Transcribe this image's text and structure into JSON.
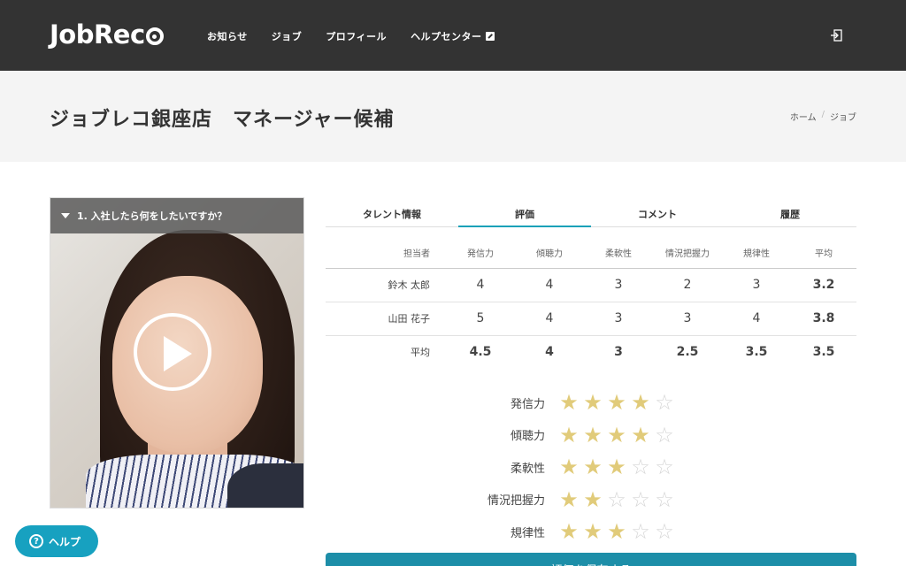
{
  "header": {
    "logo": "JobRec",
    "nav": [
      {
        "label": "お知らせ"
      },
      {
        "label": "ジョブ"
      },
      {
        "label": "プロフィール"
      },
      {
        "label": "ヘルプセンター"
      }
    ]
  },
  "page": {
    "title": "ジョブレコ銀座店　マネージャー候補",
    "breadcrumb": [
      "ホーム",
      "ジョブ"
    ]
  },
  "video": {
    "question": "1. 入社したら何をしたいですか？"
  },
  "tabs": [
    {
      "label": "タレント情報"
    },
    {
      "label": "評価"
    },
    {
      "label": "コメント"
    },
    {
      "label": "履歴"
    }
  ],
  "table": {
    "headers": [
      "担当者",
      "発信力",
      "傾聴力",
      "柔軟性",
      "情況把握力",
      "規律性",
      "平均"
    ],
    "rows": [
      [
        "鈴木 太郎",
        "4",
        "4",
        "3",
        "2",
        "3",
        "3.2"
      ],
      [
        "山田 花子",
        "5",
        "4",
        "3",
        "3",
        "4",
        "3.8"
      ],
      [
        "平均",
        "4.5",
        "4",
        "3",
        "2.5",
        "3.5",
        "3.5"
      ]
    ]
  },
  "ratings": [
    {
      "label": "発信力",
      "value": 4
    },
    {
      "label": "傾聴力",
      "value": 4
    },
    {
      "label": "柔軟性",
      "value": 3
    },
    {
      "label": "情況把握力",
      "value": 2
    },
    {
      "label": "規律性",
      "value": 3
    }
  ],
  "rating_max": 5,
  "save_label": "評価を保存する",
  "help_label": "ヘルプ",
  "colors": {
    "header_bg": "#333333",
    "accent": "#17a1b8",
    "star_on": "#e1cb7a",
    "star_off": "#d6d6d6"
  }
}
